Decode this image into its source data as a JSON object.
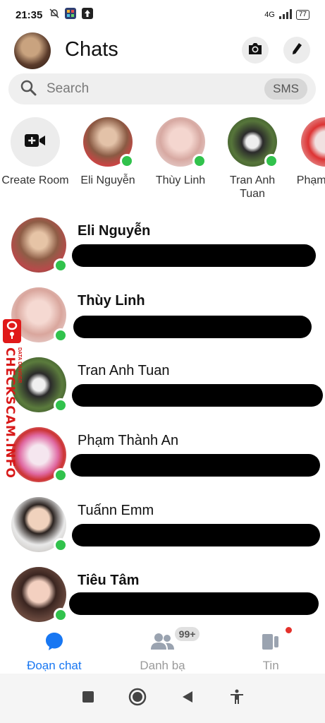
{
  "status_bar": {
    "time": "21:35",
    "network": "4G",
    "battery": "77"
  },
  "header": {
    "title": "Chats"
  },
  "search": {
    "placeholder": "Search",
    "sms_label": "SMS"
  },
  "stories": [
    {
      "label": "Create Room",
      "type": "create"
    },
    {
      "label": "Eli Nguyễn",
      "online": true,
      "color": "#b98a6a"
    },
    {
      "label": "Thùy Linh",
      "online": true,
      "color": "#e8c4c4"
    },
    {
      "label": "Tran Anh Tuan",
      "online": true,
      "color": "#4e6b3a"
    },
    {
      "label": "Phạm Thàn",
      "online": false,
      "color": "#d9c6c6"
    }
  ],
  "chats": [
    {
      "name": "Eli Nguyễn",
      "bold": true,
      "online": true,
      "color": "#a97f63"
    },
    {
      "name": "Thùy Linh",
      "bold": true,
      "online": true,
      "color": "#e2c2bd"
    },
    {
      "name": "Tran Anh Tuan",
      "bold": false,
      "online": true,
      "color": "#3f5a2d"
    },
    {
      "name": "Phạm Thành An",
      "bold": false,
      "online": true,
      "color": "#e4b8cf"
    },
    {
      "name": "Tuấnn Emm",
      "bold": false,
      "online": true,
      "color": "#c9c2b8"
    },
    {
      "name": "Tiêu Tâm",
      "bold": true,
      "online": true,
      "color": "#5b3a32"
    }
  ],
  "watermark": {
    "text": "CHECKSCAM.INFO",
    "small_text": "DATA DANGER"
  },
  "tabs": [
    {
      "label": "Đoạn chat",
      "active": true
    },
    {
      "label": "Danh bạ",
      "active": false,
      "badge": "99+"
    },
    {
      "label": "Tin",
      "active": false
    }
  ],
  "colors": {
    "accent": "#1877f2",
    "online": "#31c24c",
    "alert": "#e4312b"
  }
}
